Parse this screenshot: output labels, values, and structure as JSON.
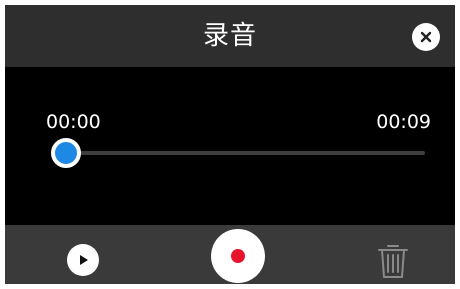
{
  "dialog": {
    "title": "录音",
    "close_icon": "close-icon"
  },
  "player": {
    "current_time": "00:00",
    "total_time": "00:09",
    "progress": 0.0
  },
  "controls": {
    "play_icon": "play-icon",
    "record_icon": "record-icon",
    "delete_icon": "trash-icon"
  },
  "colors": {
    "accent": "#1e88e5",
    "record": "#e8132d",
    "header_bg": "#2e2e2e",
    "controls_bg": "#3a3a3a"
  }
}
